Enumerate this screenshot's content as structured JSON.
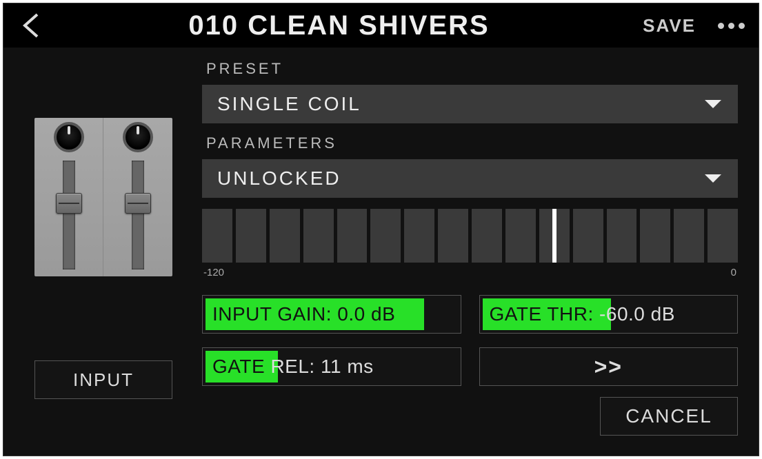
{
  "header": {
    "title": "010 CLEAN SHIVERS",
    "save_label": "SAVE"
  },
  "preset": {
    "label": "PRESET",
    "value": "SINGLE COIL"
  },
  "parameters": {
    "label": "PARAMETERS",
    "value": "UNLOCKED"
  },
  "meter": {
    "min_label": "-120",
    "max_label": "0",
    "segments": 16,
    "active_index": 10
  },
  "params": {
    "input_gain": {
      "label": "INPUT GAIN:",
      "value": "0.0 dB",
      "highlight_pct": 85
    },
    "gate_thr": {
      "label": "GATE THR:",
      "value": "-60.0 dB",
      "highlight_pct": 50
    },
    "gate_rel": {
      "label": "GATE",
      "label2": "REL:",
      "value": "11 ms",
      "highlight_pct": 28
    },
    "more_label": ">>"
  },
  "input_button_label": "INPUT",
  "cancel_label": "CANCEL",
  "icons": {
    "back": "back-triangle",
    "dropdown": "chevron-down",
    "more": "dots"
  }
}
